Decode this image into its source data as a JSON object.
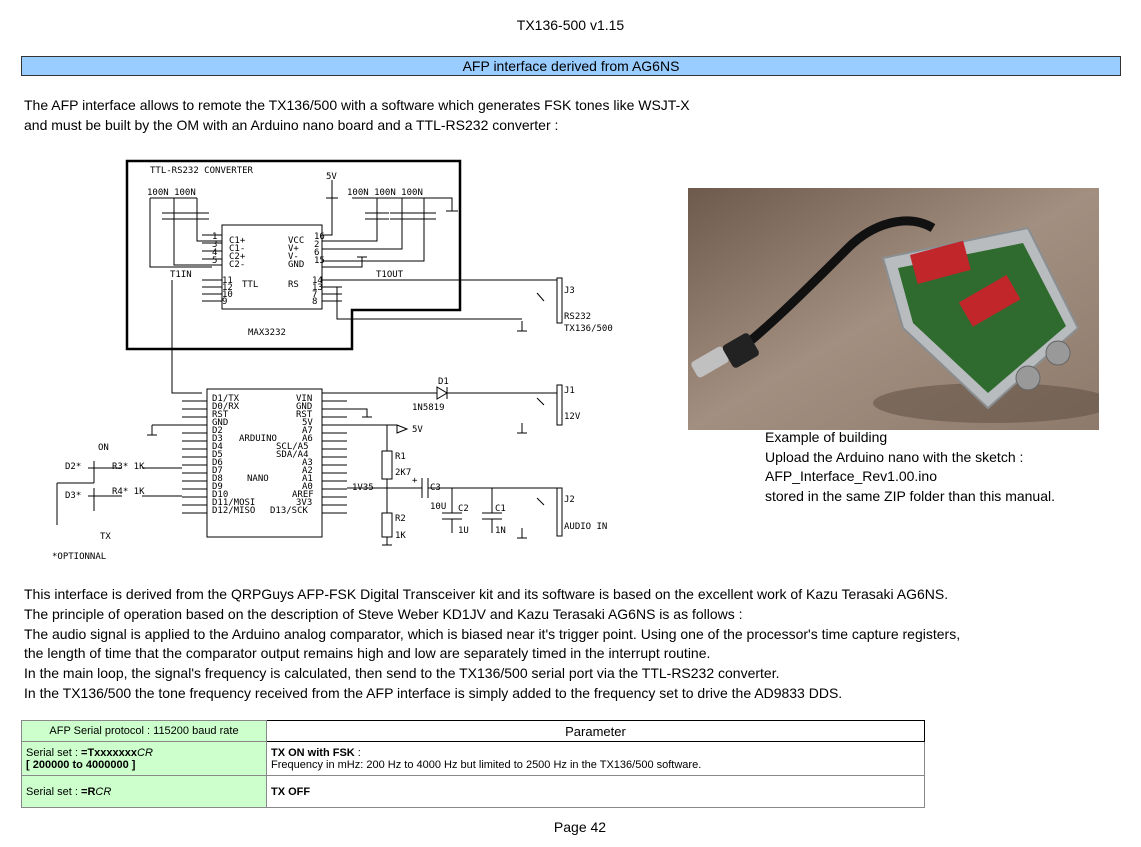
{
  "header": {
    "title": "TX136-500 v1.15"
  },
  "section": {
    "title": "AFP interface derived from AG6NS"
  },
  "intro": {
    "line1": "The AFP interface allows to remote the TX136/500 with a software which generates FSK tones like WSJT-X",
    "line2": "and must be built by the OM with an Arduino nano board and a TTL-RS232 converter :"
  },
  "schematic": {
    "converter_title": "TTL-RS232 CONVERTER",
    "cap_left": "100N 100N",
    "cap_right": "100N 100N 100N",
    "vsupply": "5V",
    "max_pins_left": [
      "C1+",
      "C1-",
      "C2+",
      "C2-"
    ],
    "max_pins_right": [
      "VCC",
      "V+",
      "V-",
      "GND"
    ],
    "max_nums_left": [
      "1",
      "3",
      "4",
      "5"
    ],
    "max_nums_right": [
      "16",
      "2",
      "6",
      "15"
    ],
    "t1in": "T1IN",
    "t1out": "T1OUT",
    "ttl": "TTL",
    "rs": "RS",
    "ttl_nums_left": [
      "11",
      "12",
      "10",
      "9"
    ],
    "ttl_nums_right": [
      "14",
      "13",
      "7",
      "8"
    ],
    "max_name": "MAX3232",
    "j3": "J3",
    "j3_label1": "RS232",
    "j3_label2": "TX136/500",
    "d1": "D1",
    "d1_part": "1N5819",
    "j1": "J1",
    "j1_label": "12V",
    "v5": "5V",
    "ard_left": [
      "D1/TX",
      "D0/RX",
      "RST",
      "GND",
      "D2",
      "D3",
      "D4",
      "D5",
      "D6",
      "D7",
      "D8",
      "D9",
      "D10",
      "D11/MOSI",
      "D12/MISO"
    ],
    "ard_right": [
      "VIN",
      "GND",
      "RST",
      "5V",
      "A7",
      "A6",
      "SCL/A5",
      "SDA/A4",
      "A3",
      "A2",
      "A1",
      "A0",
      "AREF",
      "3V3",
      "D13/SCK"
    ],
    "ard_name": "ARDUINO",
    "nano": "NANO",
    "r1": "R1",
    "r1_val": "2K7",
    "r2": "R2",
    "r2_val": "1K",
    "v135": "1V35",
    "c3": "C3",
    "c3_val": "10U",
    "plus": "+",
    "c2": "C2",
    "c2_val": "1U",
    "c1": "C1",
    "c1_val": "1N",
    "j2": "J2",
    "j2_label": "AUDIO IN",
    "on": "ON",
    "d2": "D2*",
    "d3": "D3*",
    "r3": "R3* 1K",
    "r4": "R4* 1K",
    "tx": "TX",
    "optional": "*OPTIONNAL"
  },
  "photo_caption": {
    "line1": "Example of building",
    "line2": "Upload the Arduino nano with the sketch :",
    "line3": "AFP_Interface_Rev1.00.ino",
    "line4": "stored in the same ZIP folder than this manual."
  },
  "body": {
    "p1": "This interface is derived from the QRPGuys AFP-FSK Digital Transceiver kit and its software is based on the excellent work of Kazu Terasaki AG6NS.",
    "p2": "The principle of operation based on the description of Steve Weber KD1JV and Kazu Terasaki AG6NS is as follows :",
    "p3": "The audio signal is applied to the Arduino analog comparator, which is biased near it's trigger point. Using one of the processor's time capture registers,",
    "p4": "the length of time that the comparator output remains high and low are separately timed in the interrupt routine.",
    "p5": "In the main loop, the signal's frequency is calculated, then send to the TX136/500 serial port via the TTL-RS232 converter.",
    "p6": "In the TX136/500 the tone frequency received from the AFP interface is simply added to the frequency set to drive the AD9833 DDS."
  },
  "table": {
    "header_left": "AFP Serial protocol : 115200 baud rate",
    "header_right": "Parameter",
    "row1": {
      "prefix": "Serial set : ",
      "cmd": "=Txxxxxxx",
      "cr": "CR",
      "range": "[ 200000 to 4000000 ]",
      "param_title": "TX ON with FSK",
      "param_colon": " :",
      "param_desc": "Frequency in mHz: 200 Hz to 4000 Hz but limited to 2500 Hz in the TX136/500 software."
    },
    "row2": {
      "prefix": "Serial set : ",
      "cmd": "=R",
      "cr": "CR",
      "param_title": "TX OFF"
    }
  },
  "footer": {
    "page": "Page 42"
  },
  "colors": {
    "section_bar": "#99ccff",
    "table_green": "#ccffcc"
  }
}
